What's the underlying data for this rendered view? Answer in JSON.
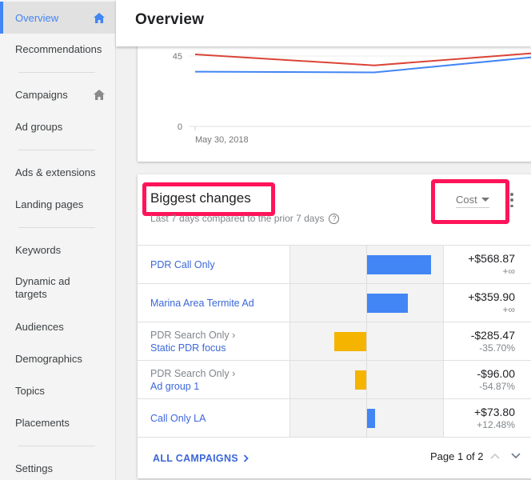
{
  "sidebar": {
    "items": [
      {
        "label": "Overview",
        "active": true,
        "icon": "home-icon"
      },
      {
        "label": "Recommendations"
      },
      {
        "label": "Campaigns",
        "icon": "home-icon"
      },
      {
        "label": "Ad groups"
      },
      {
        "label": "Ads & extensions"
      },
      {
        "label": "Landing pages"
      },
      {
        "label": "Keywords"
      },
      {
        "label": "Dynamic ad targets"
      },
      {
        "label": "Audiences"
      },
      {
        "label": "Demographics"
      },
      {
        "label": "Topics"
      },
      {
        "label": "Placements"
      },
      {
        "label": "Settings"
      }
    ]
  },
  "header": {
    "title": "Overview"
  },
  "chart_data": {
    "type": "line",
    "y_ticks": [
      "45",
      "0"
    ],
    "x_tick_labels": [
      "May 30, 2018"
    ],
    "ylim": [
      0,
      45
    ],
    "grid": true,
    "series": [
      {
        "name": "series-red",
        "color": "#db4437",
        "values": [
          46,
          39,
          47
        ]
      },
      {
        "name": "series-blue",
        "color": "#4285f4",
        "values": [
          35,
          34.5,
          44.5
        ]
      }
    ]
  },
  "changes": {
    "title": "Biggest changes",
    "subtitle": "Last 7 days compared to the prior 7 days",
    "metric": "Cost",
    "colors": {
      "positive": "#4285f4",
      "negative": "#f4b400"
    },
    "rows": [
      {
        "parent": "",
        "name": "PDR Call Only",
        "change": 568.87,
        "amount": "+$568.87",
        "pct": "+∞"
      },
      {
        "parent": "",
        "name": "Marina Area Termite Ad",
        "change": 359.9,
        "amount": "+$359.90",
        "pct": "+∞"
      },
      {
        "parent": "PDR Search Only ›",
        "name": "Static PDR focus",
        "change": -285.47,
        "amount": "-$285.47",
        "pct": "-35.70%"
      },
      {
        "parent": "PDR Search Only ›",
        "name": "Ad group 1",
        "change": -96.0,
        "amount": "-$96.00",
        "pct": "-54.87%"
      },
      {
        "parent": "",
        "name": "Call Only LA",
        "change": 73.8,
        "amount": "+$73.80",
        "pct": "+12.48%"
      }
    ],
    "footer_link": "ALL CAMPAIGNS",
    "pager": "Page 1 of 2"
  }
}
